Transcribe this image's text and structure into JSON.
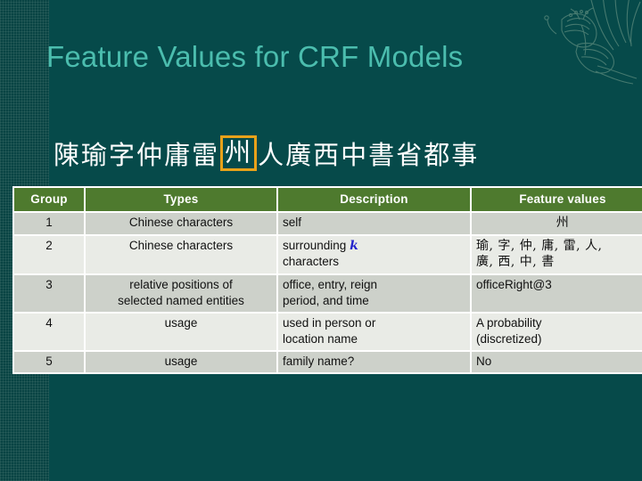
{
  "slide": {
    "title": "Feature Values for CRF Models",
    "background_color": "#064A4A",
    "title_color": "#4BBDAE",
    "header_color": "#4E7A2E",
    "highlight_color": "#E8A21A"
  },
  "example_sentence": {
    "characters": [
      "陳",
      "瑜",
      "字",
      "仲",
      "庸",
      "雷",
      "州",
      "人",
      "廣",
      "西",
      "中",
      "書",
      "省",
      "都",
      "事"
    ],
    "highlighted_index": 6,
    "highlighted_character": "州",
    "full_text": "陳瑜字仲庸雷州人廣西中書省都事"
  },
  "table": {
    "columns": [
      "Group",
      "Types",
      "Description",
      "Feature values"
    ],
    "rows": [
      {
        "group": "1",
        "types": "Chinese characters",
        "description": "self",
        "description_suffix": "",
        "values": "州"
      },
      {
        "group": "2",
        "types": "Chinese characters",
        "description": "surrounding ",
        "description_var": "k",
        "description_suffix": "characters",
        "values_line1": "瑜, 字, 仲, 庸, 雷, 人,",
        "values_line2": "廣, 西, 中, 書"
      },
      {
        "group": "3",
        "types_line1": "relative positions of",
        "types_line2": "selected named entities",
        "description_line1": "office, entry, reign",
        "description_line2": "period, and time",
        "values": "officeRight@3"
      },
      {
        "group": "4",
        "types": "usage",
        "description_line1": "used in person or",
        "description_line2": "location name",
        "values_line1": "A probability",
        "values_line2": "(discretized)"
      },
      {
        "group": "5",
        "types": "usage",
        "description": "family name?",
        "values": "No"
      }
    ]
  },
  "decorations": {
    "left_strip": "textured-strip",
    "corner_art": "butterfly-flourish"
  }
}
